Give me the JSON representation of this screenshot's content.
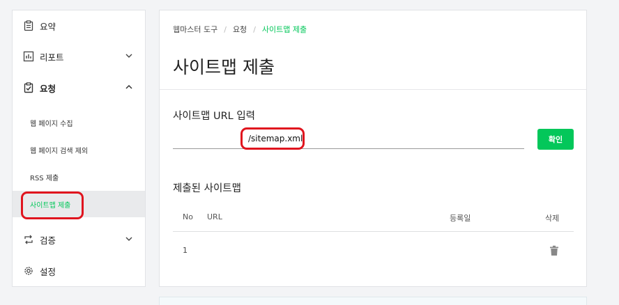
{
  "sidebar": {
    "summary": "요약",
    "report": "리포트",
    "request": "요청",
    "sub_items": [
      "웹 페이지 수집",
      "웹 페이지 검색 제외",
      "RSS 제출",
      "사이트맵 제출"
    ],
    "verify": "검증",
    "settings": "설정"
  },
  "breadcrumb": [
    "웹마스터 도구",
    "요청",
    "사이트맵 제출"
  ],
  "page_title": "사이트맵 제출",
  "url_section": {
    "title": "사이트맵 URL 입력",
    "input_value": "/sitemap.xml",
    "confirm_label": "확인"
  },
  "submitted": {
    "title": "제출된 사이트맵",
    "columns": [
      "No",
      "URL",
      "등록일",
      "삭제"
    ],
    "rows": [
      {
        "no": "1",
        "url": "",
        "date": ""
      }
    ]
  },
  "colors": {
    "accent": "#03c75a",
    "highlight": "#e0141e"
  }
}
